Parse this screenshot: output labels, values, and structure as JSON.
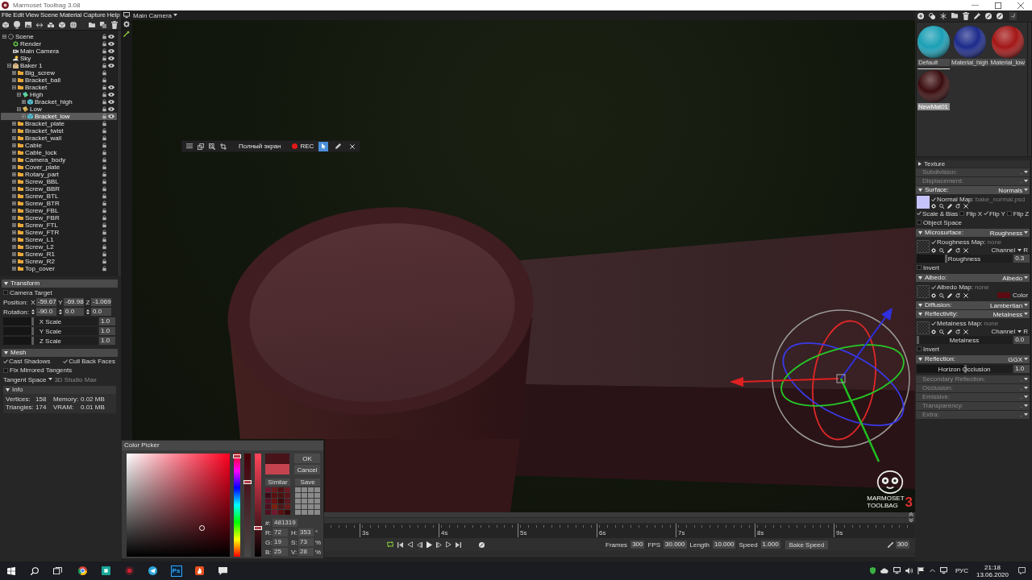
{
  "window": {
    "title": "Marmoset Toolbag 3.08"
  },
  "menu": [
    "File",
    "Edit",
    "View",
    "Scene",
    "Material",
    "Capture",
    "Help"
  ],
  "scene_tree": [
    {
      "label": "Scene",
      "kind": "scene",
      "expanded": true,
      "visible": true,
      "selected": false,
      "children": [
        {
          "label": "Render",
          "kind": "render",
          "visible": true,
          "selected": false
        },
        {
          "label": "Main Camera",
          "kind": "camera",
          "visible": true,
          "selected": false
        },
        {
          "label": "Sky",
          "kind": "sky",
          "visible": true,
          "selected": false
        },
        {
          "label": "Baker 1",
          "kind": "baker",
          "expanded": true,
          "visible": true,
          "selected": false,
          "children": [
            {
              "label": "Big_screw",
              "kind": "folder",
              "expanded": false,
              "visible": false,
              "selected": false
            },
            {
              "label": "Bracket_ball",
              "kind": "folder",
              "expanded": false,
              "visible": false,
              "selected": false
            },
            {
              "label": "Bracket",
              "kind": "folder",
              "expanded": true,
              "visible": true,
              "selected": false,
              "children": [
                {
                  "label": "High",
                  "kind": "high",
                  "expanded": true,
                  "visible": true,
                  "selected": false,
                  "children": [
                    {
                      "label": "Bracket_high",
                      "kind": "mesh",
                      "expanded": false,
                      "visible": true,
                      "selected": false
                    }
                  ]
                },
                {
                  "label": "Low",
                  "kind": "low",
                  "expanded": true,
                  "visible": true,
                  "selected": false,
                  "children": [
                    {
                      "label": "Bracket_low",
                      "kind": "mesh",
                      "expanded": false,
                      "visible": true,
                      "selected": true
                    }
                  ]
                }
              ]
            },
            {
              "label": "Bracket_plate",
              "kind": "folder",
              "expanded": false,
              "visible": false,
              "selected": false
            },
            {
              "label": "Bracket_twist",
              "kind": "folder",
              "expanded": false,
              "visible": false,
              "selected": false
            },
            {
              "label": "Bracket_wall",
              "kind": "folder",
              "expanded": false,
              "visible": false,
              "selected": false
            },
            {
              "label": "Cable",
              "kind": "folder",
              "expanded": false,
              "visible": false,
              "selected": false
            },
            {
              "label": "Cable_lock",
              "kind": "folder",
              "expanded": false,
              "visible": false,
              "selected": false
            },
            {
              "label": "Camera_body",
              "kind": "folder",
              "expanded": false,
              "visible": false,
              "selected": false
            },
            {
              "label": "Cover_plate",
              "kind": "folder",
              "expanded": false,
              "visible": false,
              "selected": false
            },
            {
              "label": "Rotary_part",
              "kind": "folder",
              "expanded": false,
              "visible": false,
              "selected": false
            },
            {
              "label": "Screw_BBL",
              "kind": "folder",
              "expanded": false,
              "visible": false,
              "selected": false
            },
            {
              "label": "Screw_BBR",
              "kind": "folder",
              "expanded": false,
              "visible": false,
              "selected": false
            },
            {
              "label": "Screw_BTL",
              "kind": "folder",
              "expanded": false,
              "visible": false,
              "selected": false
            },
            {
              "label": "Screw_BTR",
              "kind": "folder",
              "expanded": false,
              "visible": false,
              "selected": false
            },
            {
              "label": "Screw_FBL",
              "kind": "folder",
              "expanded": false,
              "visible": false,
              "selected": false
            },
            {
              "label": "Screw_FBR",
              "kind": "folder",
              "expanded": false,
              "visible": false,
              "selected": false
            },
            {
              "label": "Screw_FTL",
              "kind": "folder",
              "expanded": false,
              "visible": false,
              "selected": false
            },
            {
              "label": "Screw_FTR",
              "kind": "folder",
              "expanded": false,
              "visible": false,
              "selected": false
            },
            {
              "label": "Screw_L1",
              "kind": "folder",
              "expanded": false,
              "visible": false,
              "selected": false
            },
            {
              "label": "Screw_L2",
              "kind": "folder",
              "expanded": false,
              "visible": false,
              "selected": false
            },
            {
              "label": "Screw_R1",
              "kind": "folder",
              "expanded": false,
              "visible": false,
              "selected": false
            },
            {
              "label": "Screw_R2",
              "kind": "folder",
              "expanded": false,
              "visible": false,
              "selected": false
            },
            {
              "label": "Top_cover",
              "kind": "folder",
              "expanded": false,
              "visible": false,
              "selected": false
            }
          ]
        }
      ]
    }
  ],
  "transform": {
    "title": "Transform",
    "expanded": true,
    "camera_target": {
      "label": "Camera Target",
      "checked": false
    },
    "position": {
      "label": "Position:",
      "fields": [
        {
          "axis": "X",
          "value": "-59.67"
        },
        {
          "axis": "Y",
          "value": "-69.98"
        },
        {
          "axis": "Z",
          "value": "-1.069"
        }
      ]
    },
    "rotation": {
      "label": "Rotation:",
      "fields": [
        {
          "value": "-90.0"
        },
        {
          "value": "0.0"
        },
        {
          "value": "0.0"
        }
      ]
    },
    "scale": [
      {
        "label": "X Scale",
        "value": "1.0",
        "level": 0.3
      },
      {
        "label": "Y Scale",
        "value": "1.0",
        "level": 0.3
      },
      {
        "label": "Z Scale",
        "value": "1.0",
        "level": 0.3
      }
    ]
  },
  "mesh": {
    "title": "Mesh",
    "expanded": true,
    "option_rows": [
      [
        {
          "label": "Cast Shadows",
          "checked": true
        },
        {
          "label": "Cull Back Faces",
          "checked": true
        }
      ],
      [
        {
          "label": "Fix Mirrored Tangents",
          "checked": false
        }
      ]
    ],
    "tangent_space": {
      "label": "Tangent Space",
      "value": "3D Studio Max"
    },
    "info": {
      "title": "Info",
      "expanded": true,
      "stats": [
        {
          "label": "Vertices:",
          "value": "158"
        },
        {
          "label": "Memory:",
          "value": "0.02 MB"
        },
        {
          "label": "Triangles:",
          "value": "174"
        },
        {
          "label": "VRAM:",
          "value": "0.01 MB"
        }
      ]
    }
  },
  "viewport": {
    "camera": "Main Camera",
    "capture_toolbar": {
      "fullscreen": "Полный экран",
      "rec": "REC",
      "tools": [
        {
          "kind": "pointer",
          "selected": true
        },
        {
          "kind": "pen",
          "selected": false
        }
      ]
    },
    "logo": {
      "brand": "MARMOSET",
      "product": "TOOLBAG",
      "version": "3"
    }
  },
  "color_picker": {
    "title": "Color Picker",
    "hue": {
      "level": 0.98
    },
    "saturation": {
      "level": 0.73
    },
    "value": {
      "level": 0.28
    },
    "preview": [
      {
        "color": "#481319"
      },
      {
        "color": "#c4434f"
      }
    ],
    "buttons": [
      {
        "label": "OK"
      },
      {
        "label": "Cancel"
      }
    ],
    "similar": {
      "label": "Similar",
      "swatches": [
        {
          "color": "#6a1830"
        },
        {
          "color": "#6a1a1a"
        },
        {
          "color": "#501010"
        },
        {
          "color": "#6a1a22"
        },
        {
          "color": "#3a0a18"
        },
        {
          "color": "#5a1010"
        },
        {
          "color": "#4a1010"
        },
        {
          "color": "#5a1418"
        },
        {
          "color": "#5a1028"
        },
        {
          "color": "#6a1010"
        },
        {
          "color": "#3a0a0a"
        },
        {
          "color": "#5a1820"
        },
        {
          "color": "#4a1020"
        },
        {
          "color": "#7a2010"
        },
        {
          "color": "#4a1818"
        },
        {
          "color": "#6a1a1a"
        },
        {
          "color": "#50101c"
        },
        {
          "color": "#701a30"
        },
        {
          "color": "#581010"
        },
        {
          "color": "#3a0808"
        }
      ]
    },
    "save": {
      "label": "Save"
    },
    "hex": {
      "label": "#:",
      "value": "481319"
    },
    "rgb": [
      {
        "label": "R:",
        "value": "72"
      },
      {
        "label": "G:",
        "value": "19"
      },
      {
        "label": "B:",
        "value": "25"
      }
    ],
    "hsv": [
      {
        "label": "H:",
        "value": "353",
        "unit": "°"
      },
      {
        "label": "S:",
        "value": "73",
        "unit": "%"
      },
      {
        "label": "V:",
        "value": "28",
        "unit": "%"
      }
    ]
  },
  "timeline": {
    "ruler": [
      "3s",
      "4s",
      "5s",
      "6s",
      "7s",
      "8s",
      "9s"
    ],
    "loop": {
      "on": true
    },
    "settings": [
      {
        "label": "Frames",
        "value": "300"
      },
      {
        "label": "FPS",
        "value": "30.000"
      },
      {
        "label": "Length",
        "value": "10.000"
      },
      {
        "label": "Speed",
        "value": "1.000"
      }
    ],
    "bake_speed": "Bake Speed",
    "end_frame": "300"
  },
  "material_browser": {
    "filter": "-/",
    "materials": [
      {
        "name": "Default",
        "color": "#1b9fb5",
        "selected": false
      },
      {
        "name": "Material_high",
        "color": "#1c2a8a",
        "selected": false
      },
      {
        "name": "Material_low",
        "color": "#a31616",
        "selected": false
      },
      {
        "name": "NewMat01",
        "color": "#3a0c0e",
        "selected": true
      }
    ]
  },
  "material_editor": {
    "texture": {
      "label": "Texture",
      "expanded": false
    },
    "sections": [
      {
        "title": "Subdivision:",
        "value": "-",
        "disabled": true
      },
      {
        "title": "Displacement:",
        "value": "-",
        "disabled": true
      },
      {
        "title": "Surface:",
        "value": "Normals",
        "disabled": false,
        "expanded": true,
        "rows": [
          {
            "kind": "map",
            "label": "Normal Map:",
            "file": "bake_normal.psd",
            "checked": true,
            "preview": {
              "color": "#c6c3fb"
            }
          },
          {
            "kind": "checks",
            "items": [
              {
                "label": "Scale & Bias",
                "checked": true
              },
              {
                "label": "Flip X",
                "checked": false
              },
              {
                "label": "Flip Y",
                "checked": true
              },
              {
                "label": "Flip Z",
                "checked": false
              }
            ]
          },
          {
            "kind": "check",
            "label": "Object Space",
            "checked": false
          }
        ]
      },
      {
        "title": "Microsurface:",
        "value": "Roughness",
        "disabled": false,
        "expanded": true,
        "rows": [
          {
            "kind": "map",
            "label": "Roughness Map:",
            "file": "none",
            "checked": true,
            "channel": {
              "label": "Channel",
              "value": "R"
            }
          },
          {
            "kind": "slider",
            "label": "Roughness",
            "value": "0.3",
            "level": 0.3
          },
          {
            "kind": "check",
            "label": "Invert",
            "checked": false
          }
        ]
      },
      {
        "title": "Albedo:",
        "value": "Albedo",
        "disabled": false,
        "expanded": true,
        "rows": [
          {
            "kind": "map",
            "label": "Albedo Map:",
            "file": "none",
            "checked": true,
            "color_swatch": {
              "label": "Color",
              "color": "#5c0b12"
            }
          }
        ]
      },
      {
        "title": "Diffusion:",
        "value": "Lambertian",
        "disabled": false,
        "expanded": true
      },
      {
        "title": "Reflectivity:",
        "value": "Metalness",
        "disabled": false,
        "expanded": true,
        "rows": [
          {
            "kind": "map",
            "label": "Metalness Map:",
            "file": "none",
            "checked": true,
            "channel": {
              "label": "Channel",
              "value": "R"
            }
          },
          {
            "kind": "slider",
            "label": "Metalness",
            "value": "0.0",
            "level": 0.0
          },
          {
            "kind": "check",
            "label": "Invert",
            "checked": false
          }
        ]
      },
      {
        "title": "Reflection:",
        "value": "GGX",
        "disabled": false,
        "expanded": true,
        "rows": [
          {
            "kind": "slider",
            "label": "Horizon Occlusion",
            "value": "1.0",
            "level": 0.5
          }
        ]
      },
      {
        "title": "Secondary Reflection:",
        "value": "-",
        "disabled": true
      },
      {
        "title": "Occlusion:",
        "value": "-",
        "disabled": true
      },
      {
        "title": "Emissive:",
        "value": "-",
        "disabled": true
      },
      {
        "title": "Transparency:",
        "value": "-",
        "disabled": true
      },
      {
        "title": "Extra:",
        "value": "-",
        "disabled": true
      }
    ]
  },
  "taskbar": {
    "apps": [
      {
        "kind": "browser"
      },
      {
        "kind": "tile"
      },
      {
        "kind": "recorder"
      },
      {
        "kind": "messenger"
      },
      {
        "kind": "text",
        "label": "Ps"
      },
      {
        "kind": "flame"
      },
      {
        "kind": "chat"
      }
    ],
    "tray": {
      "language": "РУС",
      "time": "21:18",
      "date": "13.06.2020"
    }
  }
}
